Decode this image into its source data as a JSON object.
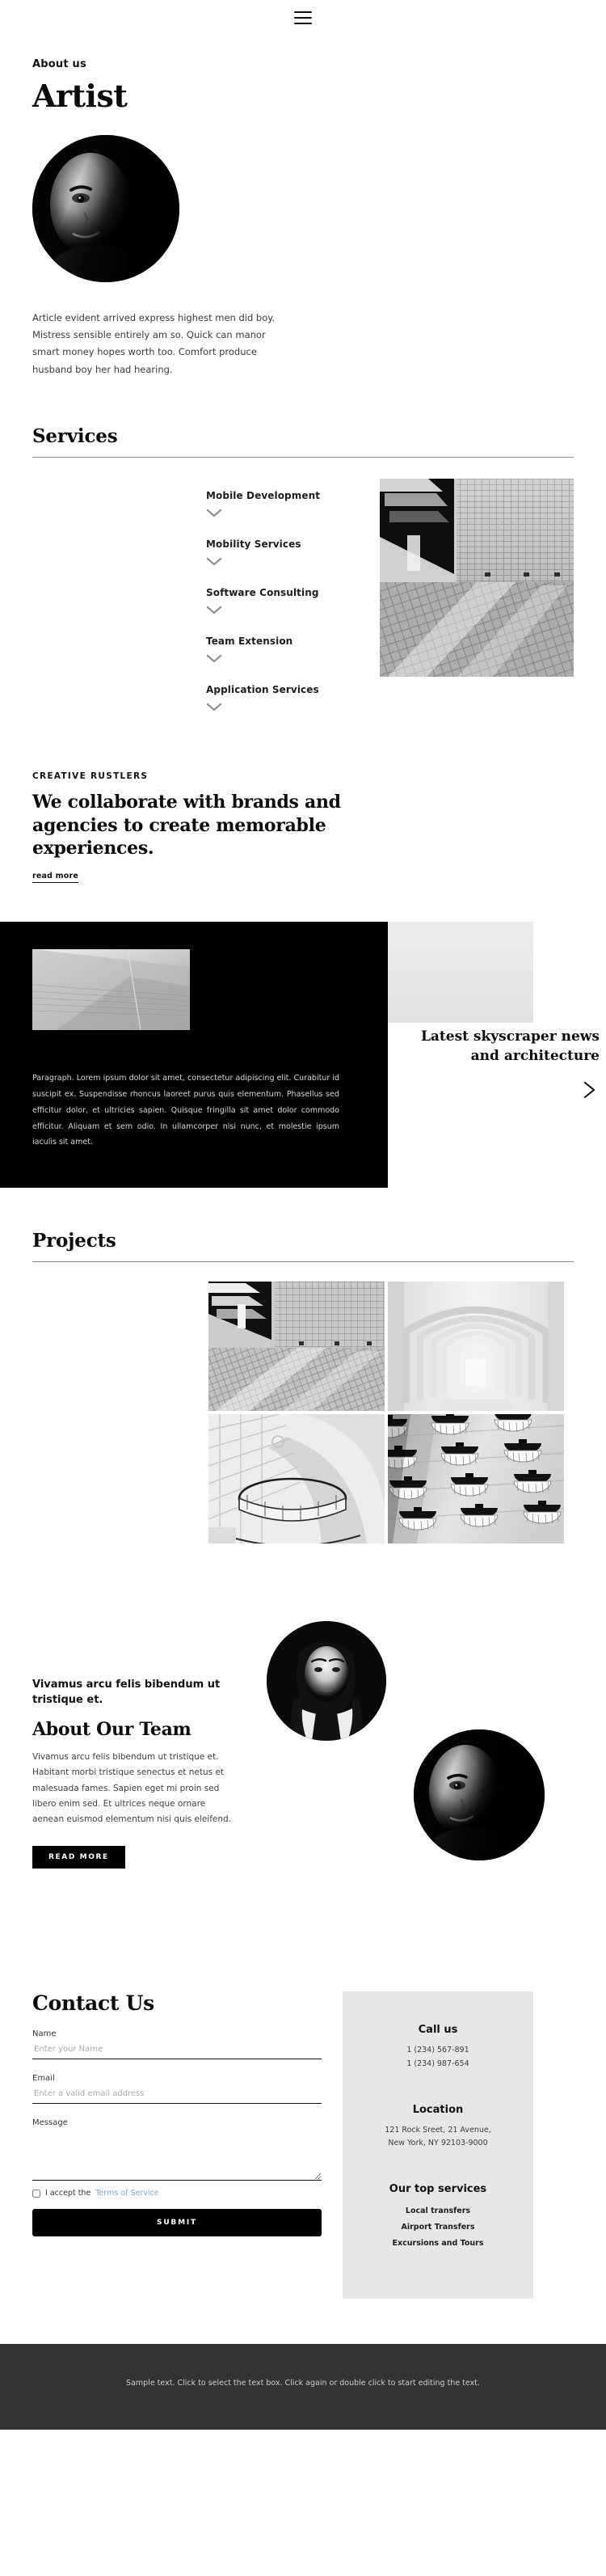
{
  "header": {
    "menu_icon": "hamburger-icon"
  },
  "hero": {
    "eyebrow": "About us",
    "title": "Artist",
    "paragraph": "Article evident arrived express highest men did boy. Mistress sensible entirely am so. Quick can manor smart money hopes worth too. Comfort produce husband boy her had hearing."
  },
  "services": {
    "heading": "Services",
    "items": [
      {
        "label": "Mobile Development",
        "icon": "chevron-down-icon"
      },
      {
        "label": "Mobility Services",
        "icon": "chevron-down-icon"
      },
      {
        "label": "Software Consulting",
        "icon": "chevron-down-icon"
      },
      {
        "label": "Team Extension",
        "icon": "chevron-down-icon"
      },
      {
        "label": "Application Services",
        "icon": "chevron-down-icon"
      }
    ]
  },
  "collaborate": {
    "eyebrow": "CREATIVE RUSTLERS",
    "title": "We collaborate with brands and agencies to create memorable experiences.",
    "link": "read more"
  },
  "dark_block": {
    "paragraph": "Paragraph. Lorem ipsum dolor sit amet, consectetur adipiscing elit. Curabitur id suscipit ex. Suspendisse rhoncus laoreet purus quis elementum. Phasellus sed efficitur dolor, et ultricies sapien. Quisque fringilla sit amet dolor commodo efficitur. Aliquam et sem odio. In ullamcorper nisi nunc, et molestie ipsum iaculis sit amet.",
    "latest_title": "Latest skyscraper news and architecture",
    "arrow_icon": "chevron-right-icon"
  },
  "projects": {
    "heading": "Projects",
    "tiles": [
      {
        "alt": "angular-building-shadows-photo"
      },
      {
        "alt": "white-arches-corridor-photo"
      },
      {
        "alt": "curved-balcony-interior-photo"
      },
      {
        "alt": "stacked-balconies-facade-photo"
      }
    ]
  },
  "team": {
    "kicker": "Vivamus arcu felis bibendum ut tristique et.",
    "title": "About Our Team",
    "paragraph": "Vivamus arcu felis bibendum ut tristique et. Habitant morbi tristique senectus et netus et malesuada fames. Sapien eget mi proin sed libero enim sed. Et ultrices neque ornare aenean euismod elementum nisi quis eleifend.",
    "button": "READ MORE",
    "photo_a": "woman-portrait-photo",
    "photo_b": "man-portrait-photo"
  },
  "contact": {
    "title": "Contact Us",
    "name_label": "Name",
    "name_placeholder": "Enter your Name",
    "name_value": "",
    "email_label": "Email",
    "email_placeholder": "Enter a valid email address",
    "email_value": "",
    "message_label": "Message",
    "message_placeholder": "",
    "message_value": "",
    "tos_prefix": "I accept the",
    "tos_link": "Terms of Service",
    "submit": "SUBMIT",
    "side": {
      "call_heading": "Call us",
      "phone_1": "1 (234) 567-891",
      "phone_2": "1 (234) 987-654",
      "location_heading": "Location",
      "address_1": "121 Rock Sreet, 21 Avenue,",
      "address_2": "New York, NY 92103-9000",
      "services_heading": "Our top services",
      "services": [
        "Local transfers",
        "Airport Transfers",
        "Excursions and Tours"
      ]
    }
  },
  "footer": {
    "text": "Sample text. Click to select the text box. Click again or double click to start editing the text."
  },
  "colors": {
    "ink": "#000000",
    "paper": "#ffffff",
    "footer_bg": "#333333",
    "panel_grey": "#e7e7e7",
    "link_blue": "#7fa9cc"
  }
}
